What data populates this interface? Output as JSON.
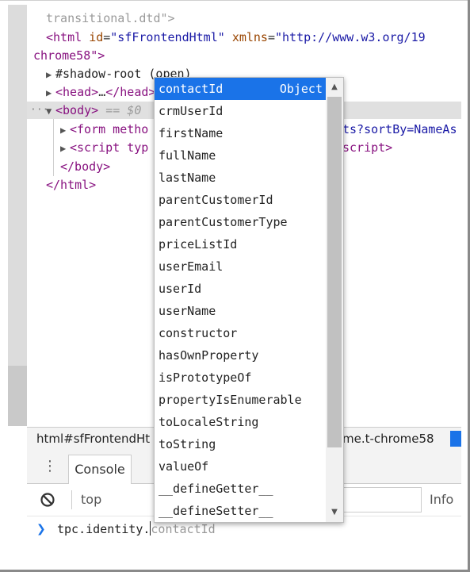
{
  "dom": {
    "line1": "transitional.dtd\">",
    "line2_tag_open": "<html",
    "line2_attr1": "id",
    "line2_val1": "\"sfFrontendHtml\"",
    "line2_attr2": "xmlns",
    "line2_val2": "\"http://www.w3.org/19",
    "line3": "chrome58\">",
    "shadow_root": "#shadow-root (open)",
    "head_open": "<head>",
    "head_ellipsis": "…",
    "head_close": "</head>",
    "body_tag": "<body>",
    "body_eq": " == $0",
    "form_tag": "<form metho",
    "form_tail": "ts?sortBy=NameAs",
    "script_tag": "<script typ",
    "script_tail": "script>",
    "body_close": "</body>",
    "html_close": "</html>"
  },
  "breadcrumb": {
    "left": "html#sfFrontendHt",
    "right": "me.t-chrome58"
  },
  "drawer": {
    "tab_console": "Console",
    "context": "top",
    "info": "Info"
  },
  "prompt": {
    "typed": "tpc.identity.",
    "suggestion": "contactId"
  },
  "autocomplete": {
    "selected_type": "Object",
    "items": [
      "contactId",
      "crmUserId",
      "firstName",
      "fullName",
      "lastName",
      "parentCustomerId",
      "parentCustomerType",
      "priceListId",
      "userEmail",
      "userId",
      "userName",
      "constructor",
      "hasOwnProperty",
      "isPrototypeOf",
      "propertyIsEnumerable",
      "toLocaleString",
      "toString",
      "valueOf",
      "__defineGetter__",
      "__defineSetter__"
    ]
  },
  "colors": {
    "accent": "#1a73e8",
    "tag": "#881280",
    "attr": "#994500",
    "value": "#1a1aa6"
  }
}
